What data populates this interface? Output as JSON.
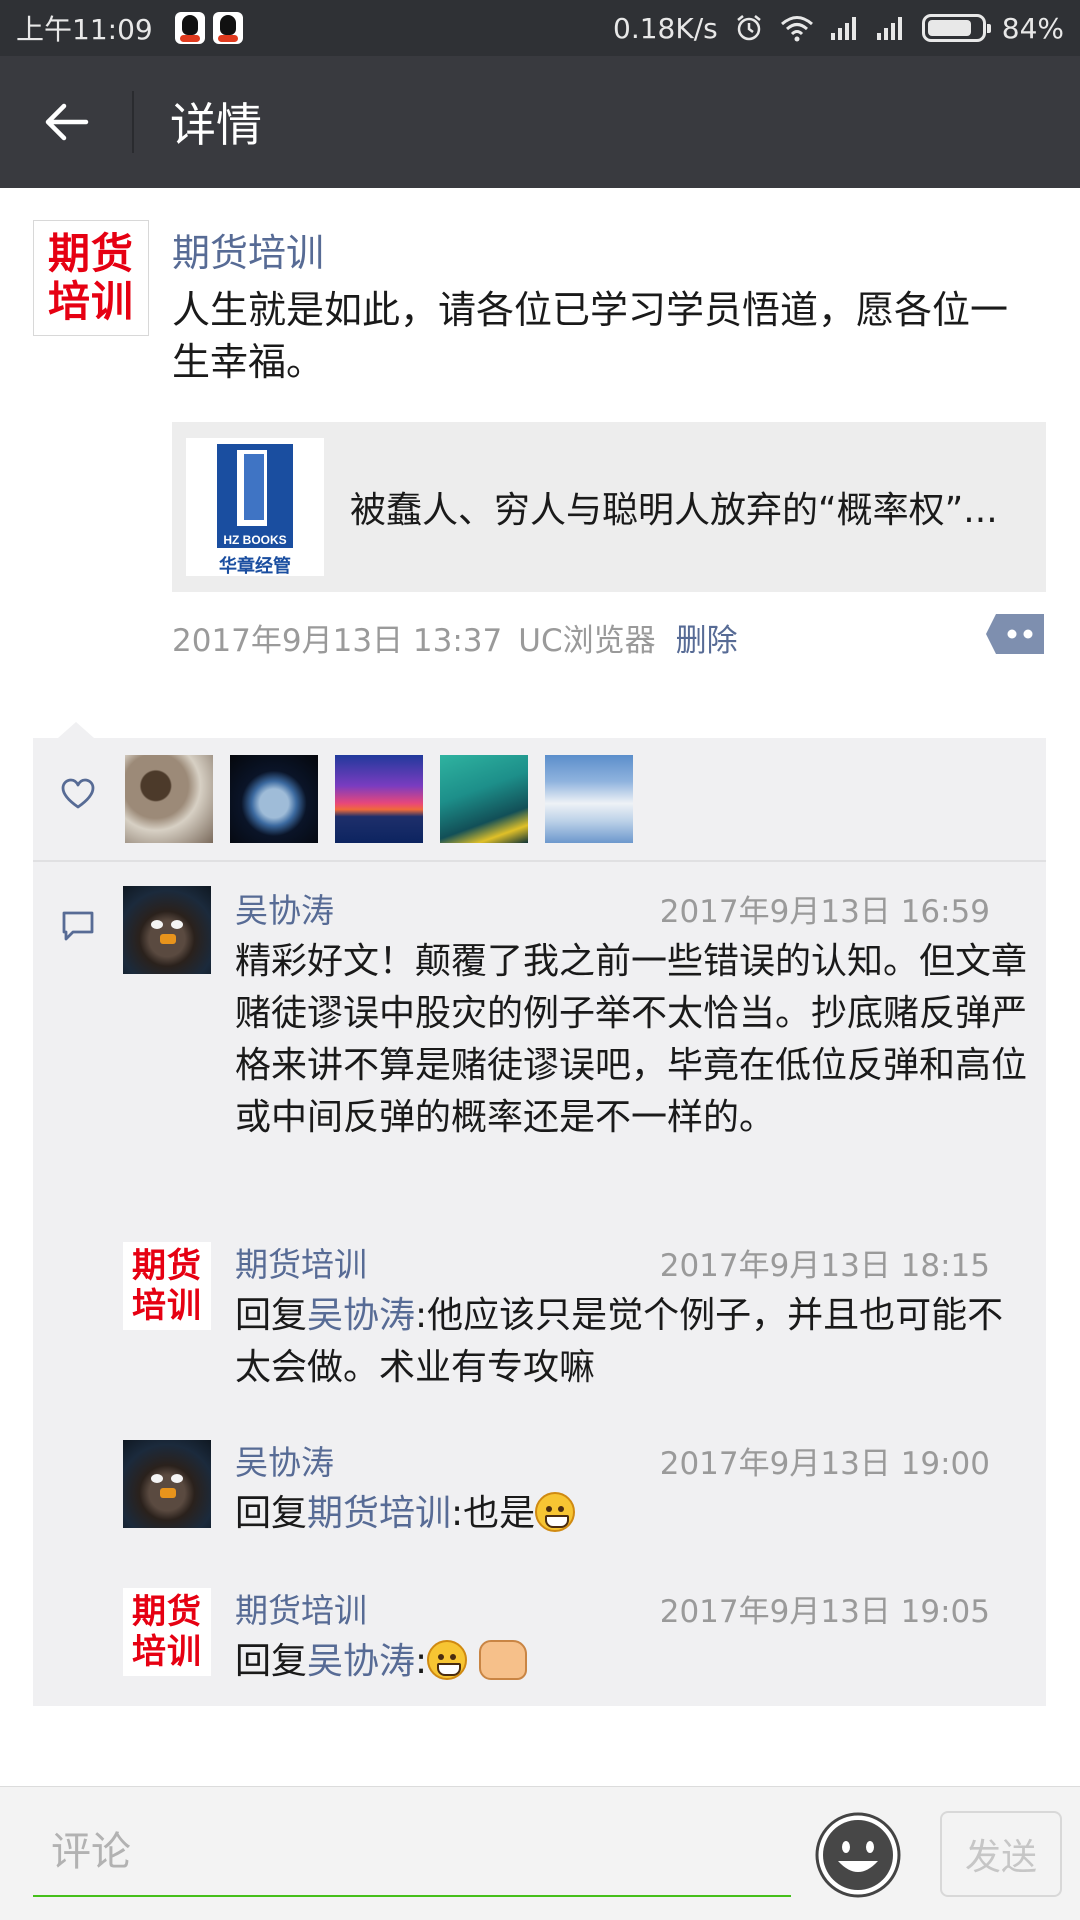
{
  "status_bar": {
    "time": "上午11:09",
    "network_speed": "0.18K/s",
    "battery": "84%",
    "battery_level": 0.84
  },
  "header": {
    "title": "详情"
  },
  "post": {
    "author": "期货培训",
    "avatar_logo_line1": "期货",
    "avatar_logo_line2": "培训",
    "text": "人生就是如此，请各位已学习学员悟道，愿各位一生幸福。",
    "link": {
      "title": "被蠢人、穷人与聪明人放弃的“概率权”...",
      "thumb_brand": "HZ BOOKS",
      "thumb_brand_cn": "华章经管"
    },
    "timestamp": "2017年9月13日 13:37",
    "source": "UC浏览器",
    "delete_label": "删除"
  },
  "likes": {
    "count": 5
  },
  "comments": [
    {
      "name": "吴协涛",
      "time": "2017年9月13日 16:59",
      "text": "精彩好文！颠覆了我之前一些错误的认知。但文章赌徒谬误中股灾的例子举不太恰当。抄底赌反弹严格来讲不算是赌徒谬误吧，毕竟在低位反弹和高位或中间反弹的概率还是不一样的。"
    },
    {
      "name": "期货培训",
      "time": "2017年9月13日 18:15",
      "reply_prefix": "回复",
      "reply_to": "吴协涛",
      "text": ":他应该只是觉个例子，并且也可能不太会做。术业有专攻嘛"
    },
    {
      "name": "吴协涛",
      "time": "2017年9月13日 19:00",
      "reply_prefix": "回复",
      "reply_to": "期货培训",
      "text": ":也是"
    },
    {
      "name": "期货培训",
      "time": "2017年9月13日 19:05",
      "reply_prefix": "回复",
      "reply_to": "吴协涛",
      "text": ":"
    }
  ],
  "input_bar": {
    "placeholder": "评论",
    "send_label": "发送"
  },
  "colors": {
    "accent_link": "#576b95",
    "title_bar": "#393a3f",
    "input_underline": "#45c01a"
  }
}
